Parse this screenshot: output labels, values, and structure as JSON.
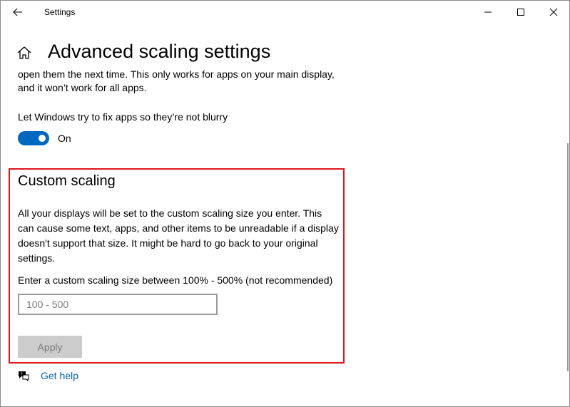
{
  "window": {
    "title": "Settings"
  },
  "page": {
    "title": "Advanced scaling settings",
    "intro_text": "open them the next time. This only works for apps on your main display, and it won’t work for all apps."
  },
  "blur_fix": {
    "label": "Let Windows try to fix apps so they’re not blurry",
    "state_text": "On",
    "enabled": true
  },
  "custom_scaling": {
    "heading": "Custom scaling",
    "description": "All your displays will be set to the custom scaling size you enter. This can cause some text, apps, and other items to be unreadable if a display doesn't support that size. It might be hard to go back to your original settings.",
    "input_label": "Enter a custom scaling size between 100% - 500% (not recommended)",
    "input_value": "",
    "input_placeholder": "100 - 500",
    "apply_label": "Apply",
    "apply_enabled": false
  },
  "help": {
    "link_label": "Get help",
    "icon": "help-chat-icon"
  },
  "colors": {
    "accent": "#0067c0",
    "highlight_border": "#e0141e",
    "link": "#0063b1",
    "disabled_button": "#cccccc"
  }
}
